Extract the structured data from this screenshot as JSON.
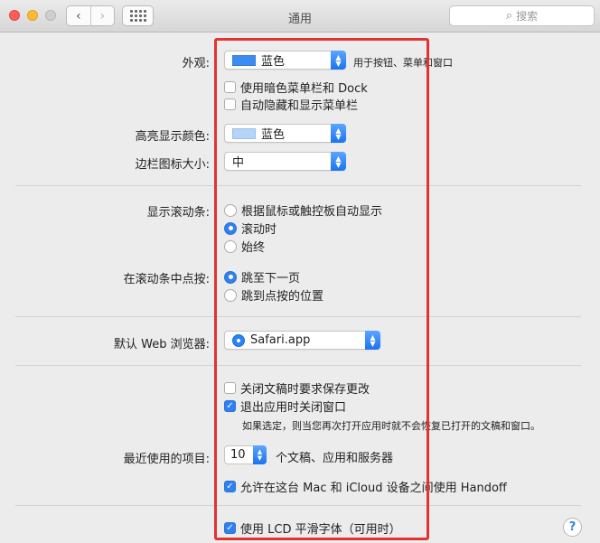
{
  "window": {
    "title": "通用",
    "search_placeholder": "搜索",
    "nav_back": "‹",
    "nav_forward": "›"
  },
  "appearance": {
    "label": "外观:",
    "value": "蓝色",
    "swatch_color": "#3a8bf2",
    "note": "用于按钮、菜单和窗口",
    "dark_menu": {
      "label": "使用暗色菜单栏和 Dock",
      "checked": false
    },
    "auto_hide": {
      "label": "自动隐藏和显示菜单栏",
      "checked": false
    }
  },
  "highlight_color": {
    "label": "高亮显示颜色:",
    "value": "蓝色",
    "swatch_color": "#b3d4fb"
  },
  "sidebar_icon_size": {
    "label": "边栏图标大小:",
    "value": "中"
  },
  "scroll_bars": {
    "label": "显示滚动条:",
    "options": [
      {
        "label": "根据鼠标或触控板自动显示",
        "selected": false
      },
      {
        "label": "滚动时",
        "selected": true
      },
      {
        "label": "始终",
        "selected": false
      }
    ]
  },
  "click_scroll": {
    "label": "在滚动条中点按:",
    "options": [
      {
        "label": "跳至下一页",
        "selected": true
      },
      {
        "label": "跳到点按的位置",
        "selected": false
      }
    ]
  },
  "browser": {
    "label": "默认 Web 浏览器:",
    "value": "Safari.app"
  },
  "documents": {
    "ask_save": {
      "label": "关闭文稿时要求保存更改",
      "checked": false
    },
    "close_windows": {
      "label": "退出应用时关闭窗口",
      "checked": true
    },
    "note": "如果选定，则当您再次打开应用时就不会恢复已打开的文稿和窗口。"
  },
  "recent_items": {
    "label": "最近使用的项目:",
    "value": "10",
    "suffix": "个文稿、应用和服务器"
  },
  "handoff": {
    "label": "允许在这台 Mac 和 iCloud 设备之间使用 Handoff",
    "checked": true
  },
  "lcd": {
    "label": "使用 LCD 平滑字体（可用时）",
    "checked": true
  },
  "help": "?",
  "accent_color": "#2f80f0",
  "annotation_color": "#e23232"
}
